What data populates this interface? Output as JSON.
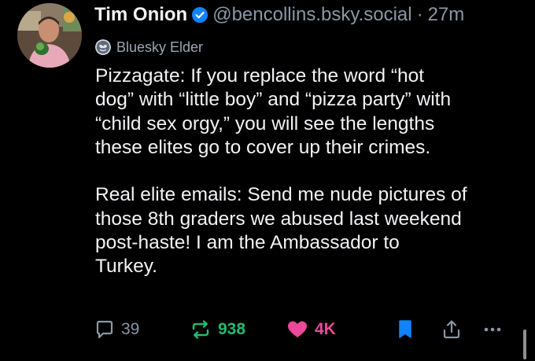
{
  "post": {
    "display_name": "Tim Onion",
    "handle": "@bencollins.bsky.social",
    "separator": "·",
    "time": "27m",
    "label": "Bluesky Elder",
    "text_lines": [
      "Pizzagate: If you replace the word “hot",
      "dog” with “little boy” and “pizza party” with",
      "“child sex orgy,” you will see the lengths",
      "these elites go to cover up their crimes.",
      "",
      "Real elite emails: Send me nude pictures of",
      "those 8th graders we abused last weekend",
      "post-haste! I am the Ambassador to",
      "Turkey."
    ]
  },
  "actions": {
    "reply_count": "39",
    "repost_count": "938",
    "like_count": "4K"
  },
  "icons": {
    "avatar": "avatar-photo",
    "verified": "verified-check-icon",
    "label": "bluesky-elder-badge-icon",
    "reply": "speech-bubble-icon",
    "repost": "repost-arrows-icon",
    "like": "heart-icon",
    "bookmark": "bookmark-icon",
    "share": "share-upload-icon",
    "more": "ellipsis-icon"
  },
  "colors": {
    "background": "#000000",
    "text": "#f1f3f5",
    "muted": "#8b97a6",
    "verified": "#1083fe",
    "repost": "#20bc6f",
    "like": "#ec4899",
    "bookmark": "#1083fe"
  }
}
